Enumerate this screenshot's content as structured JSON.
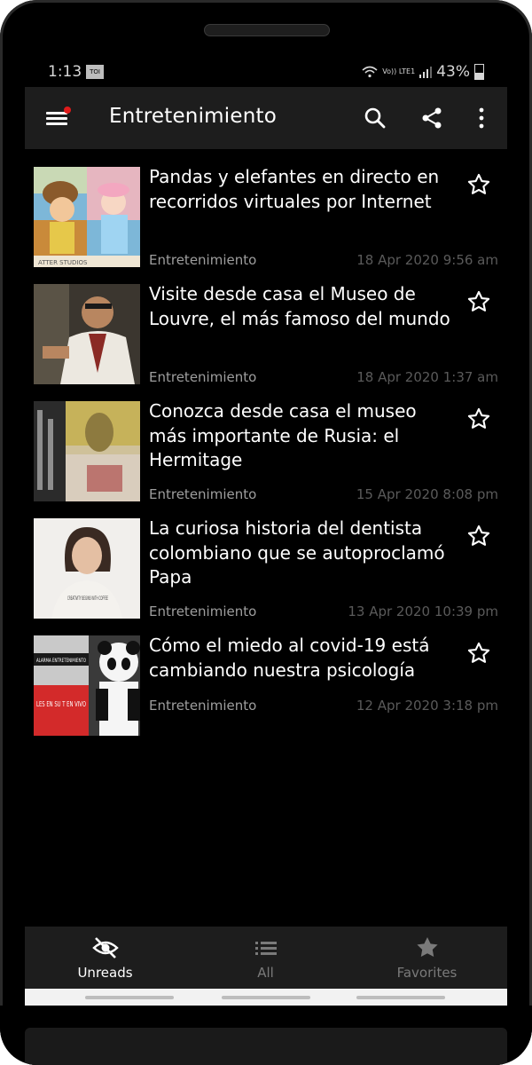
{
  "status_bar": {
    "time": "1:13",
    "app_badge": "TOI",
    "lte_label": "Vo)) LTE1",
    "battery": "43%"
  },
  "app_bar": {
    "title": "Entretenimiento"
  },
  "articles": [
    {
      "headline": "Pandas y elefantes en directo en recorridos virtuales por Internet",
      "category": "Entretenimiento",
      "date": "18 Apr 2020 9:56 am"
    },
    {
      "headline": "Visite desde casa el Museo de Louvre, el más famoso del mundo",
      "category": "Entretenimiento",
      "date": "18 Apr 2020 1:37 am"
    },
    {
      "headline": "Conozca desde casa el museo más importante de Rusia: el Hermitage",
      "category": "Entretenimiento",
      "date": "15 Apr 2020 8:08 pm"
    },
    {
      "headline": "La curiosa historia del dentista colombiano que se autoproclamó Papa",
      "category": "Entretenimiento",
      "date": "13 Apr 2020 10:39 pm"
    },
    {
      "headline": "Cómo el miedo al covid-19 está cambiando nuestra psicología",
      "category": "Entretenimiento",
      "date": "12 Apr 2020 3:18 pm"
    }
  ],
  "thumbnails": {
    "t1": {
      "caption": "ATTER STUDIOS"
    },
    "t4": {
      "shirt_text": "CREATIVITY BEGINS WITH COFFEE"
    },
    "t5": {
      "banner_top": "ALARMA ENTRETENIMIENTO",
      "banner_red": "LES EN SU T EN VIVO"
    }
  },
  "bottom_nav": {
    "tabs": [
      {
        "label": "Unreads",
        "icon": "eye-off-icon",
        "active": true
      },
      {
        "label": "All",
        "icon": "list-icon",
        "active": false
      },
      {
        "label": "Favorites",
        "icon": "star-icon",
        "active": false
      }
    ]
  },
  "colors": {
    "background": "#000000",
    "bar": "#1d1d1d",
    "accent_dot": "#e01b1b",
    "muted": "#9e9e9e"
  }
}
